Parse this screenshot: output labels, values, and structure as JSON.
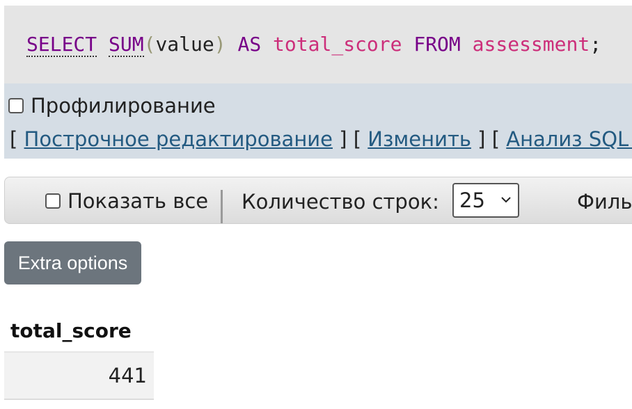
{
  "query": {
    "tokens": {
      "select": "SELECT",
      "sum": "SUM",
      "paren_open": "(",
      "column": "value",
      "paren_close": ")",
      "as": "AS",
      "alias": "total_score",
      "from": "FROM",
      "table": "assessment",
      "semicolon": ";"
    }
  },
  "query_options": {
    "profiling_label": "Профилирование",
    "profiling_checked": false,
    "bracket_open": "[",
    "bracket_close": "]",
    "links": {
      "inline_edit": "Построчное редактирование",
      "edit": "Изменить",
      "analyze": "Анализ SQL запроса"
    }
  },
  "navigation": {
    "show_all_label": "Показать все",
    "show_all_checked": false,
    "rows_label": "Количество строк:",
    "rows_value": "25",
    "filter_label": "Фильтровать строки"
  },
  "extra_options_label": "Extra options",
  "results": {
    "columns": [
      "total_score"
    ],
    "rows": [
      [
        "441"
      ]
    ]
  },
  "colors": {
    "keyword": "#770088",
    "alias": "#cc2e7a",
    "link": "#235a81",
    "button_bg": "#6c757d",
    "query_bg": "#e5e5e5",
    "options_bg": "#d5dde5"
  }
}
